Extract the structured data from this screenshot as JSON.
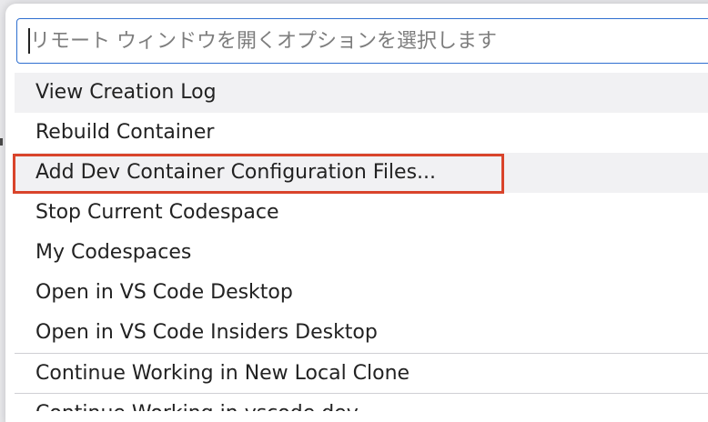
{
  "quick_pick": {
    "placeholder": "リモート ウィンドウを開くオプションを選択します",
    "value": "",
    "items": [
      {
        "label": "View Creation Log"
      },
      {
        "label": "Rebuild Container"
      },
      {
        "label": "Add Dev Container Configuration Files..."
      },
      {
        "label": "Stop Current Codespace"
      },
      {
        "label": "My Codespaces"
      },
      {
        "label": "Open in VS Code Desktop"
      },
      {
        "label": "Open in VS Code Insiders Desktop"
      },
      {
        "label": "Continue Working in New Local Clone"
      },
      {
        "label": "Continue Working in vscode.dev"
      }
    ]
  },
  "annotation": {
    "highlight_color": "#d9442b"
  },
  "colors": {
    "input_border": "#2f6fd0",
    "hover_background": "#f1f1f3",
    "text": "#222222"
  }
}
